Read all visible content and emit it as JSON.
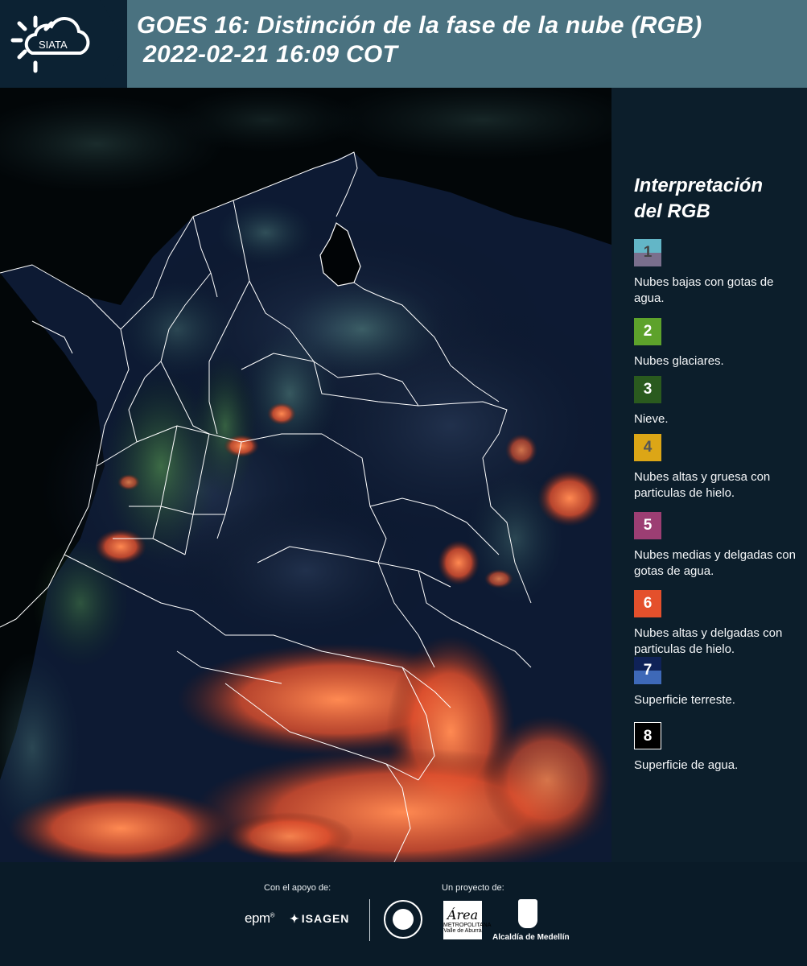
{
  "header": {
    "logo_text": "SIATA",
    "title_line1": "GOES 16: Distinción de la fase de la nube (RGB)",
    "title_line2": "2022-02-21 16:09 COT"
  },
  "legend": {
    "title": "Interpretación\ndel RGB",
    "items": [
      {
        "num": "1",
        "label": "Nubes bajas con gotas de agua.",
        "top_color": "#63b6c7",
        "bottom_color": "#7a6f8d",
        "num_color": "#444444"
      },
      {
        "num": "2",
        "label": "Nubes glaciares.",
        "top_color": "#5da22b",
        "bottom_color": "#5da22b",
        "num_color": "#ffffff"
      },
      {
        "num": "3",
        "label": "Nieve.",
        "top_color": "#2a5a1e",
        "bottom_color": "#2a5a1e",
        "num_color": "#ffffff"
      },
      {
        "num": "4",
        "label": "Nubes altas y gruesa con particulas de hielo.",
        "top_color": "#dca616",
        "bottom_color": "#dca616",
        "num_color": "#555555"
      },
      {
        "num": "5",
        "label": "Nubes medias y delgadas con gotas de agua.",
        "top_color": "#9c3e73",
        "bottom_color": "#9c3e73",
        "num_color": "#ffffff"
      },
      {
        "num": "6",
        "label": "Nubes altas y delgadas con particulas de hielo.",
        "top_color": "#e4502c",
        "bottom_color": "#e4502c",
        "num_color": "#ffffff"
      },
      {
        "num": "7",
        "label": "Superficie terreste.",
        "top_color": "#0f2257",
        "bottom_color": "#3e69b8",
        "num_color": "#ffffff"
      },
      {
        "num": "8",
        "label": "Superficie de agua.",
        "top_color": "#000000",
        "bottom_color": "#000000",
        "num_color": "#ffffff"
      }
    ]
  },
  "footer": {
    "support_label": "Con el apoyo de:",
    "project_label": "Un proyecto de:",
    "sponsor1": "epm",
    "sponsor2": "ISAGEN",
    "area_logo_big": "Área",
    "area_logo_text": "METROPOLITANA",
    "area_logo_sub": "Valle de Aburrá",
    "medellin_label": "Alcaldía de Medellín"
  }
}
